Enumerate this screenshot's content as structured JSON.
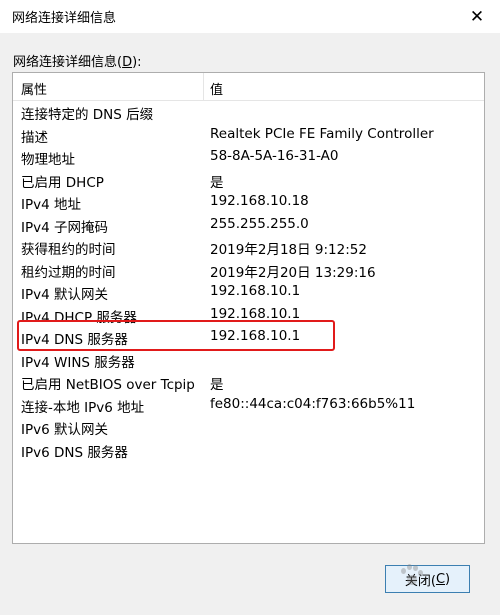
{
  "window": {
    "title": "网络连接详细信息",
    "close_glyph": "✕"
  },
  "group": {
    "label_prefix": "网络连接详细信息(",
    "label_accel": "D",
    "label_suffix": "):"
  },
  "table": {
    "headers": {
      "property": "属性",
      "value": "值"
    },
    "rows": [
      {
        "property": "连接特定的 DNS 后缀",
        "value": ""
      },
      {
        "property": "描述",
        "value": "Realtek PCIe FE Family Controller"
      },
      {
        "property": "物理地址",
        "value": "58-8A-5A-16-31-A0"
      },
      {
        "property": "已启用 DHCP",
        "value": "是"
      },
      {
        "property": "IPv4 地址",
        "value": "192.168.10.18"
      },
      {
        "property": "IPv4 子网掩码",
        "value": "255.255.255.0"
      },
      {
        "property": "获得租约的时间",
        "value": "2019年2月18日 9:12:52"
      },
      {
        "property": "租约过期的时间",
        "value": "2019年2月20日 13:29:16"
      },
      {
        "property": "IPv4 默认网关",
        "value": "192.168.10.1"
      },
      {
        "property": "IPv4 DHCP 服务器",
        "value": "192.168.10.1"
      },
      {
        "property": "IPv4 DNS 服务器",
        "value": "192.168.10.1"
      },
      {
        "property": "IPv4 WINS 服务器",
        "value": ""
      },
      {
        "property": "已启用 NetBIOS over Tcpip",
        "value": "是"
      },
      {
        "property": "连接-本地 IPv6 地址",
        "value": "fe80::44ca:c04:f763:66b5%11"
      },
      {
        "property": "IPv6 默认网关",
        "value": ""
      },
      {
        "property": "IPv6 DNS 服务器",
        "value": ""
      }
    ]
  },
  "buttons": {
    "close_prefix": "关闭(",
    "close_accel": "C",
    "close_suffix": ")"
  },
  "colors": {
    "highlight": "#e11a1a",
    "button_border": "#3c7fb1",
    "button_bg": "#e5f1fb"
  },
  "icons": {
    "window_close": "close-icon"
  }
}
